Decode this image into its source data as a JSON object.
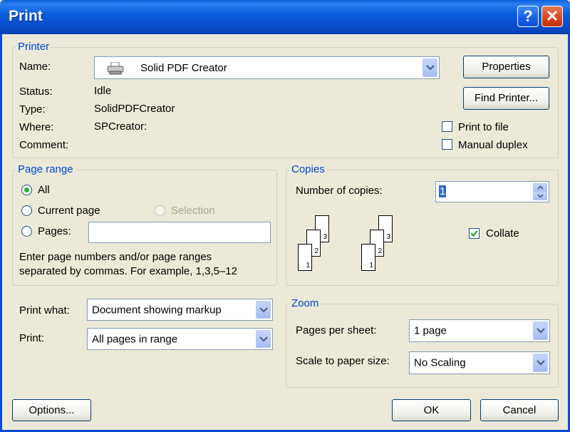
{
  "window": {
    "title": "Print",
    "help_glyph": "?",
    "close_glyph": "✕"
  },
  "printer": {
    "legend": "Printer",
    "name_label": "Name:",
    "name_value": "Solid PDF Creator",
    "status_label": "Status:",
    "status_value": "Idle",
    "type_label": "Type:",
    "type_value": "SolidPDFCreator",
    "where_label": "Where:",
    "where_value": "SPCreator:",
    "comment_label": "Comment:",
    "comment_value": "",
    "properties_button": "Properties",
    "find_printer_button": "Find Printer...",
    "print_to_file_label": "Print to file",
    "print_to_file_checked": false,
    "manual_duplex_label": "Manual duplex",
    "manual_duplex_checked": false
  },
  "page_range": {
    "legend": "Page range",
    "all_label": "All",
    "all_selected": true,
    "current_page_label": "Current page",
    "selection_label": "Selection",
    "pages_label": "Pages:",
    "pages_value": "",
    "help_line1": "Enter page numbers and/or page ranges",
    "help_line2": "separated by commas.  For example, 1,3,5–12"
  },
  "copies": {
    "legend": "Copies",
    "number_label": "Number of copies:",
    "number_value": "1",
    "collate_label": "Collate",
    "collate_checked": true,
    "page_numbers": [
      "3",
      "2",
      "1"
    ]
  },
  "print_what": {
    "label": "Print what:",
    "value": "Document showing markup"
  },
  "print": {
    "label": "Print:",
    "value": "All pages in range"
  },
  "zoom": {
    "legend": "Zoom",
    "pages_per_sheet_label": "Pages per sheet:",
    "pages_per_sheet_value": "1 page",
    "scale_label": "Scale to paper size:",
    "scale_value": "No Scaling"
  },
  "footer": {
    "options_button": "Options...",
    "ok_button": "OK",
    "cancel_button": "Cancel"
  }
}
